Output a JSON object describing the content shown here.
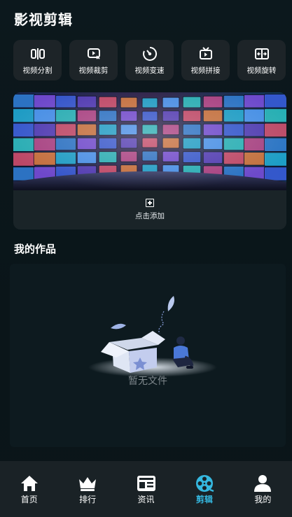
{
  "header": {
    "title": "影视剪辑"
  },
  "tools": [
    {
      "label": "视频分割",
      "icon": "split-icon"
    },
    {
      "label": "视频裁剪",
      "icon": "crop-icon"
    },
    {
      "label": "视频变速",
      "icon": "speed-icon"
    },
    {
      "label": "视频拼接",
      "icon": "join-icon"
    },
    {
      "label": "视频旋转",
      "icon": "rotate-icon"
    }
  ],
  "banner": {
    "add_label": "点击添加",
    "image": "video-wall-image"
  },
  "works": {
    "title": "我的作品",
    "empty_text": "暂无文件"
  },
  "tabbar": {
    "items": [
      {
        "label": "首页",
        "icon": "home-icon"
      },
      {
        "label": "排行",
        "icon": "crown-icon"
      },
      {
        "label": "资讯",
        "icon": "news-icon"
      },
      {
        "label": "剪辑",
        "icon": "film-reel-icon",
        "active": true
      },
      {
        "label": "我的",
        "icon": "user-icon"
      }
    ]
  },
  "colors": {
    "accent": "#35b8e0",
    "background": "#0b161b",
    "card": "#1d2428"
  }
}
